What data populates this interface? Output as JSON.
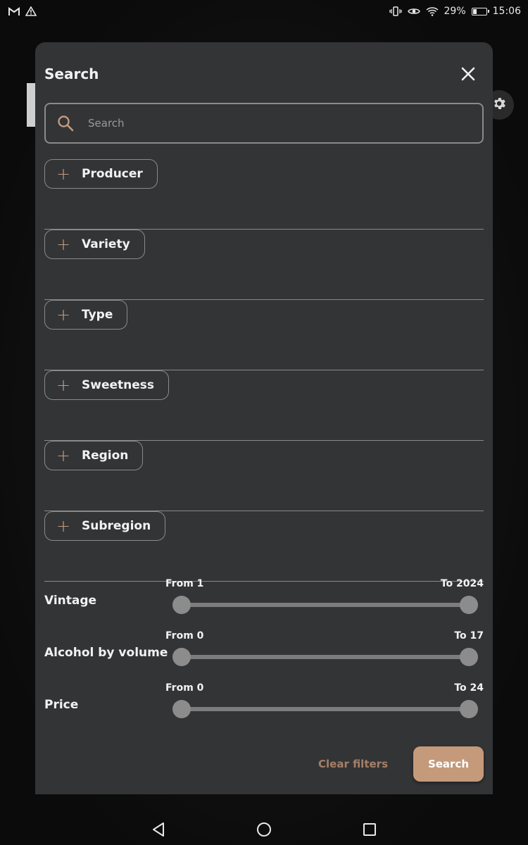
{
  "statusbar": {
    "battery": "29%",
    "battery_level": 0.29,
    "time": "15:06",
    "icons": [
      "gmail-icon",
      "warning-icon",
      "vibrate-icon",
      "eye-icon",
      "wifi-icon",
      "battery-icon"
    ]
  },
  "modal": {
    "title": "Search",
    "search_placeholder": "Search",
    "filters": [
      {
        "label": "Producer"
      },
      {
        "label": "Variety"
      },
      {
        "label": "Type"
      },
      {
        "label": "Sweetness"
      },
      {
        "label": "Region"
      },
      {
        "label": "Subregion"
      }
    ],
    "ranges": [
      {
        "label": "Vintage",
        "from_label": "From 1",
        "to_label": "To 2024",
        "from": 1,
        "to": 2024
      },
      {
        "label": "Alcohol by volume",
        "from_label": "From 0",
        "to_label": "To 17",
        "from": 0,
        "to": 17
      },
      {
        "label": "Price",
        "from_label": "From 0",
        "to_label": "To 24",
        "from": 0,
        "to": 24
      }
    ],
    "clear_label": "Clear filters",
    "search_label": "Search"
  },
  "colors": {
    "accent": "#c49a7b",
    "accent_text": "#a57f66",
    "modal_bg": "#333436",
    "border": "#8a8a8a"
  }
}
